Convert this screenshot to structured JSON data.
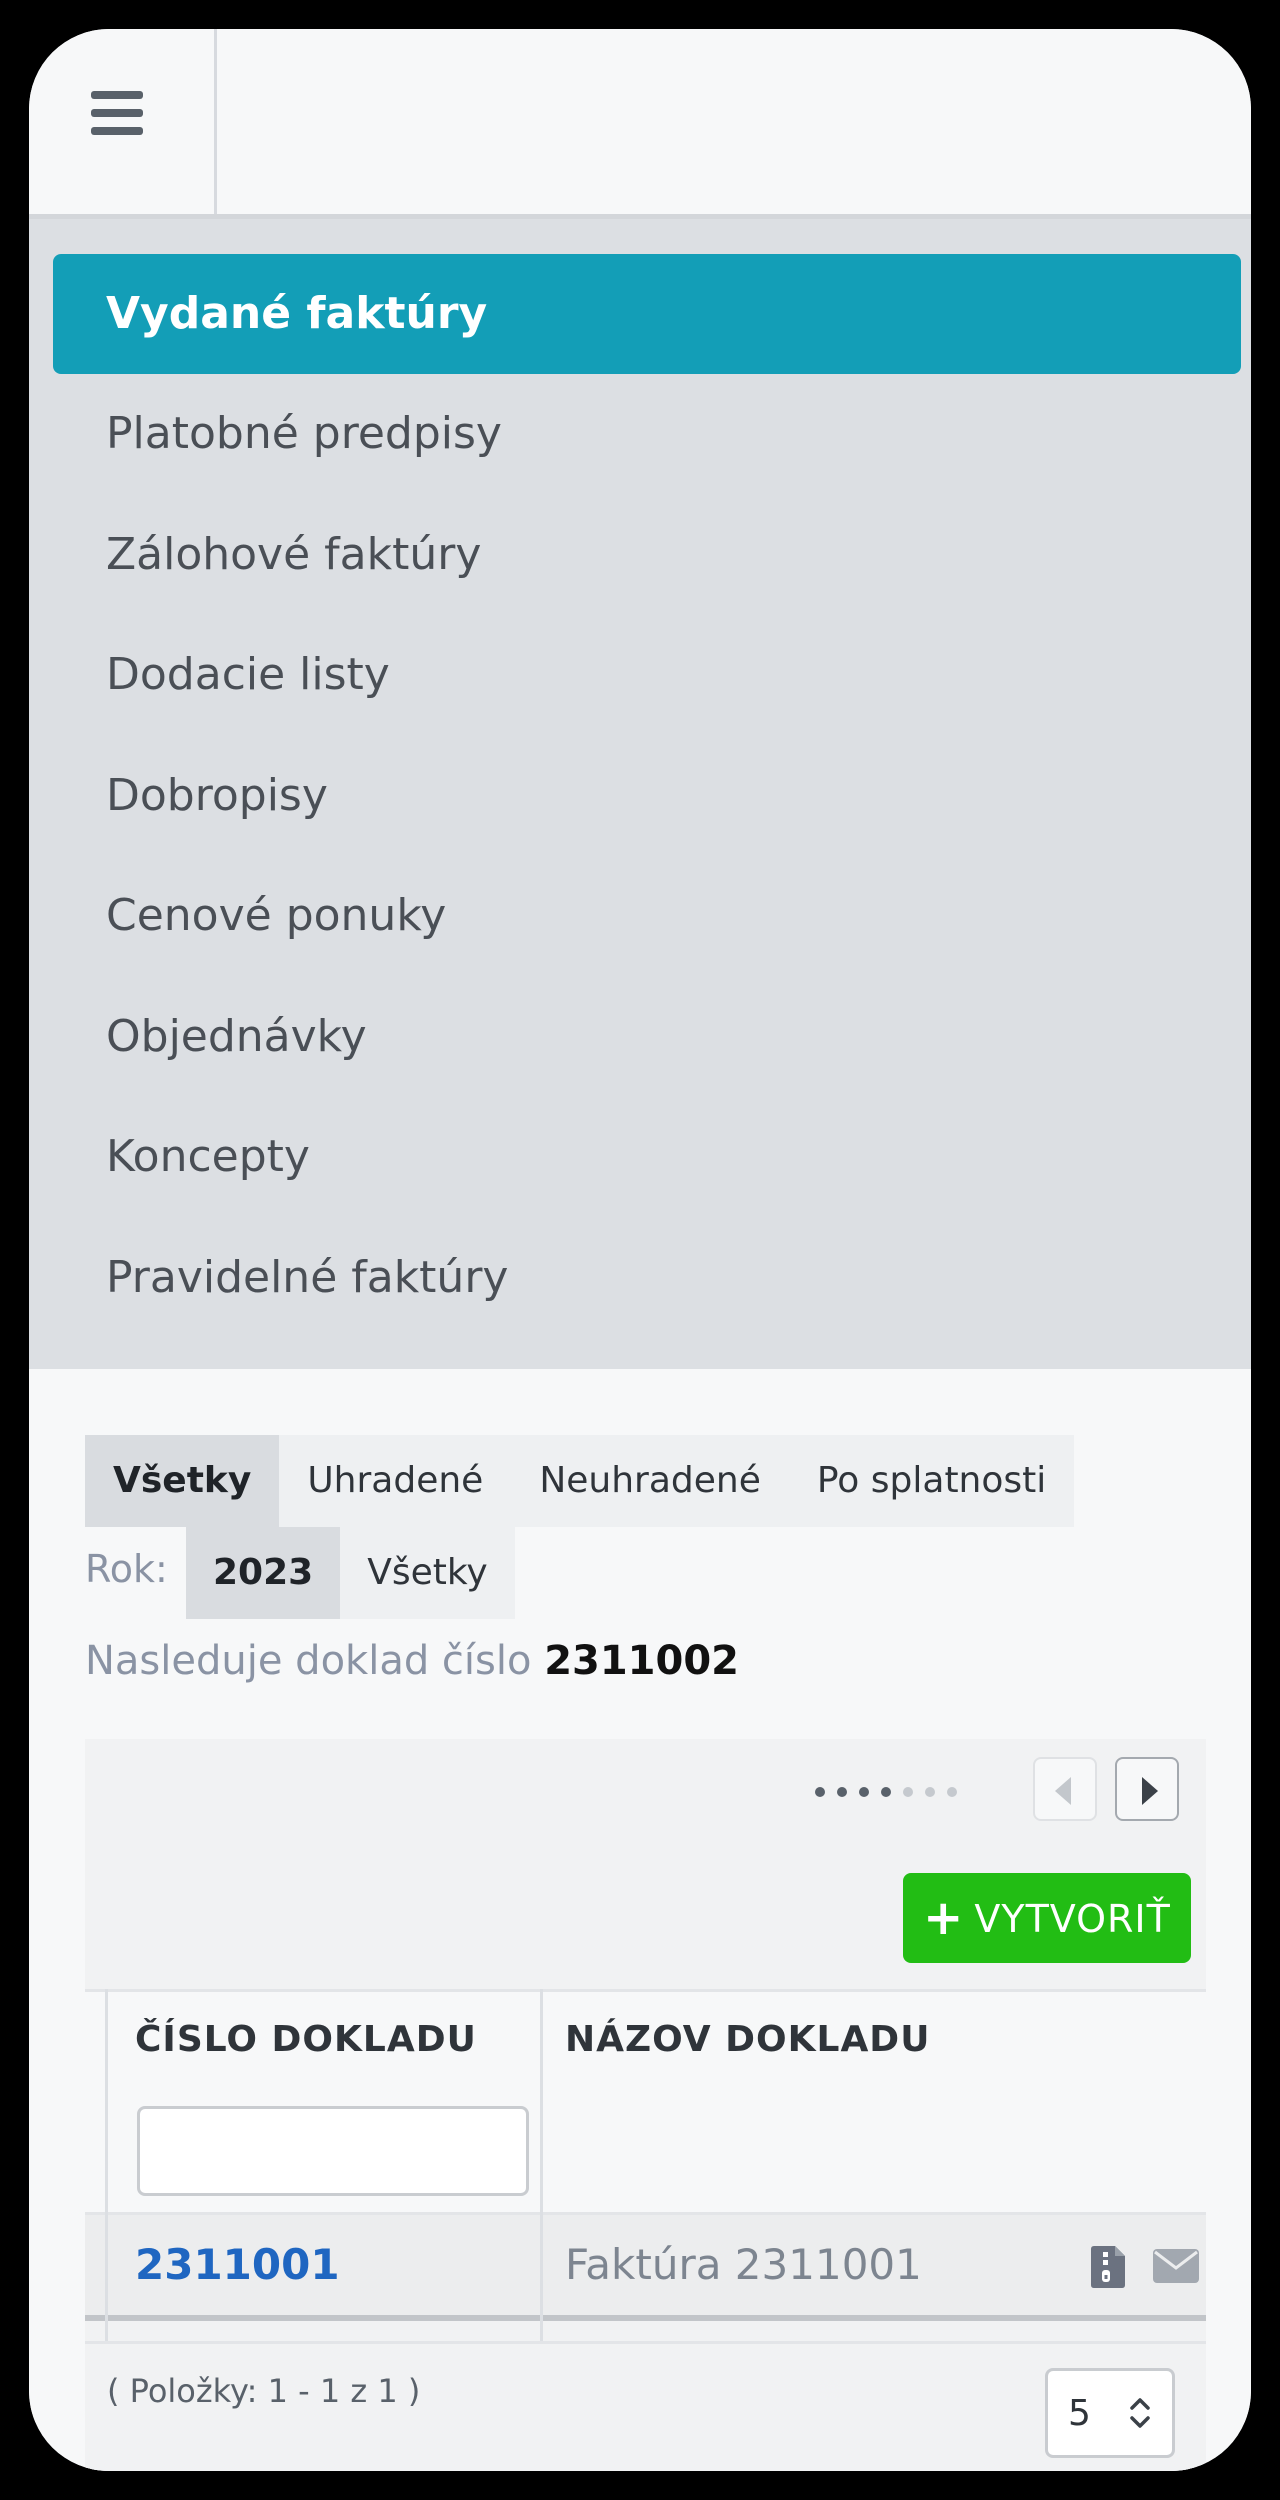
{
  "menu": {
    "items": [
      {
        "label": "Vydané faktúry",
        "active": true
      },
      {
        "label": "Platobné predpisy"
      },
      {
        "label": "Zálohové faktúry"
      },
      {
        "label": "Dodacie listy"
      },
      {
        "label": "Dobropisy"
      },
      {
        "label": "Cenové ponuky"
      },
      {
        "label": "Objednávky"
      },
      {
        "label": "Koncepty"
      },
      {
        "label": "Pravidelné faktúry"
      }
    ]
  },
  "filters": {
    "status_tabs": [
      {
        "label": "Všetky",
        "active": true
      },
      {
        "label": "Uhradené"
      },
      {
        "label": "Neuhradené"
      },
      {
        "label": "Po splatnosti"
      }
    ],
    "year_label": "Rok:",
    "year_tabs": [
      {
        "label": "2023",
        "active": true
      },
      {
        "label": "Všetky"
      }
    ]
  },
  "next_document": {
    "prefix": "Nasleduje doklad číslo",
    "number": "2311002"
  },
  "grid": {
    "create_button_label": "VYTVORIŤ",
    "columns": {
      "number": "ČÍSLO DOKLADU",
      "name": "NÁZOV DOKLADU"
    },
    "rows": [
      {
        "number": "2311001",
        "name": "Faktúra 2311001"
      }
    ],
    "footer_text": "( Položky: 1 - 1 z 1 )",
    "page_size": "5"
  },
  "colors": {
    "accent": "#139eb7",
    "create": "#22bd14",
    "link": "#1f66c1"
  }
}
